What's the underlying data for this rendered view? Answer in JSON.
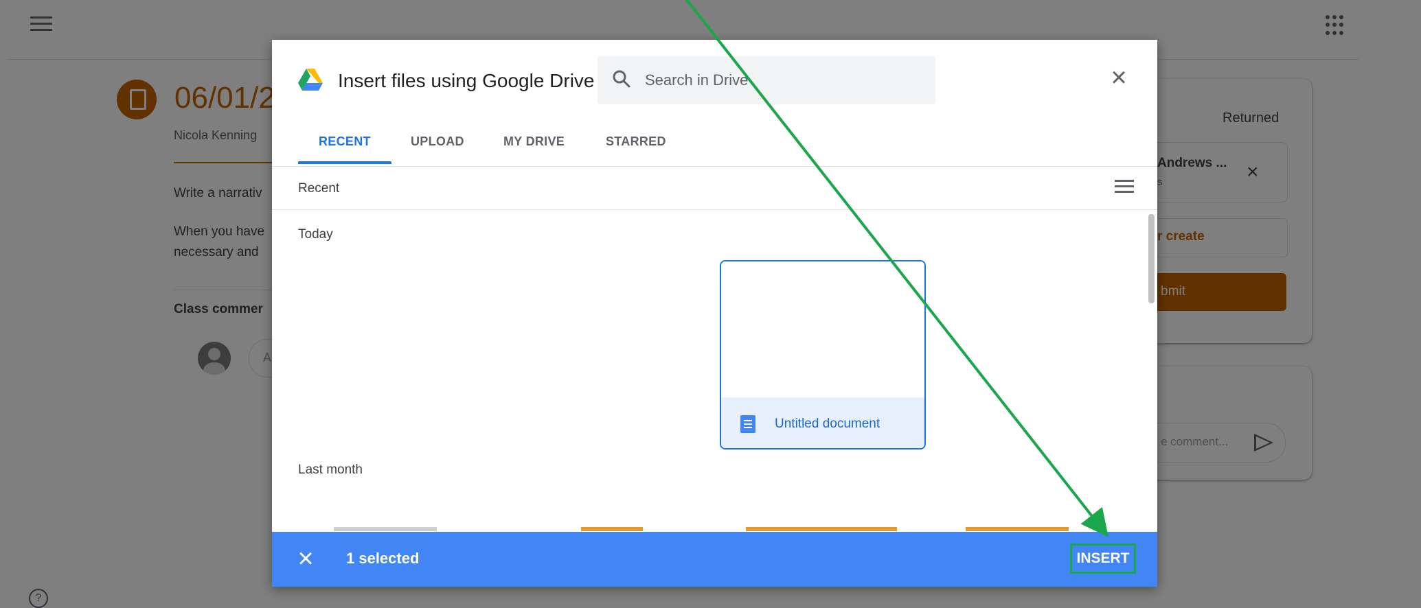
{
  "background": {
    "assignment": {
      "title": "06/01/2",
      "author": "Nicola Kenning",
      "description_lines": [
        "Write a narrativ",
        "When you have",
        "necessary and"
      ],
      "class_comments_label": "Class commer",
      "comment_placeholder": "A"
    },
    "your_work": {
      "status": "Returned",
      "attachment_name": "Andrews ...",
      "attachment_sub": "s",
      "add_create_label": "r create",
      "submit_label": "bmit"
    },
    "private_comments": {
      "placeholder": "e comment..."
    },
    "help_label": "?"
  },
  "dialog": {
    "title": "Insert files using Google Drive",
    "search": {
      "placeholder": "Search in Drive"
    },
    "close_icon": "close-icon",
    "tabs": [
      {
        "label": "RECENT",
        "active": true
      },
      {
        "label": "UPLOAD",
        "active": false
      },
      {
        "label": "MY DRIVE",
        "active": false
      },
      {
        "label": "STARRED",
        "active": false
      }
    ],
    "breadcrumb": "Recent",
    "sections": [
      {
        "label": "Today",
        "files": [
          {
            "name": "Untitled document",
            "type": "doc",
            "selected": true
          }
        ]
      },
      {
        "label": "Last month"
      }
    ],
    "action_bar": {
      "selected_text": "1 selected",
      "insert_label": "INSERT"
    }
  },
  "colors": {
    "accent_blue": "#1a73e8",
    "action_bar": "#4285f4",
    "classroom_orange": "#c26401",
    "annotation_green": "#1aa64a"
  }
}
